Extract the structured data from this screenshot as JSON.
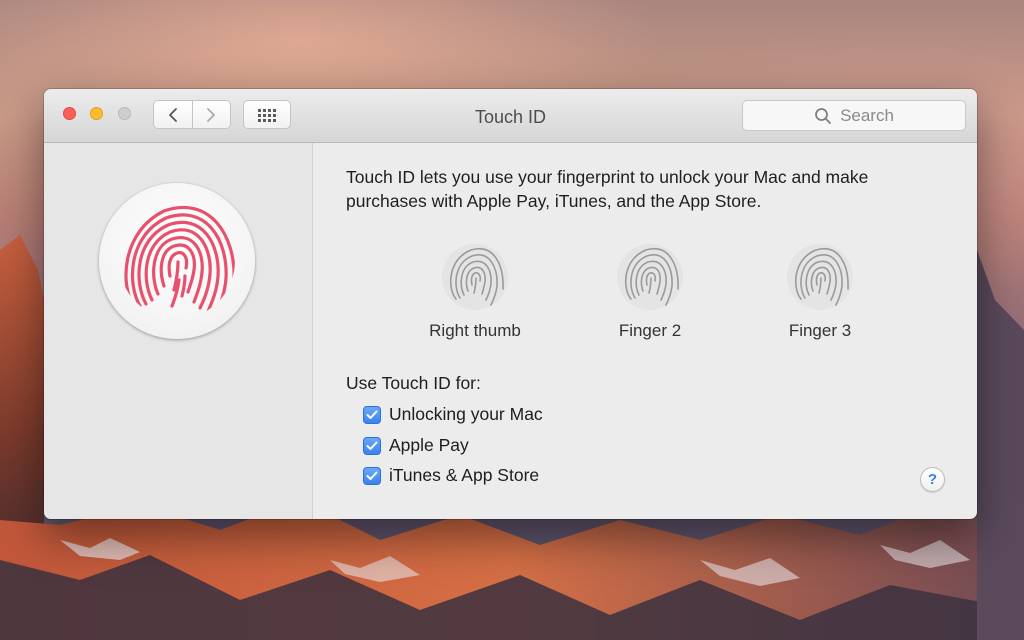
{
  "window": {
    "title": "Touch ID",
    "search": {
      "placeholder": "Search",
      "icon": "search-icon"
    }
  },
  "main": {
    "description": "Touch ID lets you use your fingerprint to unlock your Mac and make purchases with Apple Pay, iTunes, and the App Store.",
    "fingers": [
      {
        "label": "Right thumb"
      },
      {
        "label": "Finger 2"
      },
      {
        "label": "Finger 3"
      }
    ],
    "use_for": {
      "heading": "Use Touch ID for:",
      "options": [
        {
          "label": "Unlocking your Mac",
          "checked": true
        },
        {
          "label": "Apple Pay",
          "checked": true
        },
        {
          "label": "iTunes & App Store",
          "checked": true
        }
      ]
    },
    "help_label": "?"
  },
  "colors": {
    "close": "#fc5f57",
    "minimize": "#fdbc2e",
    "zoom": "#cfcfcf",
    "fingerprint_accent": "#e8506d",
    "checkbox": "#3b82f0"
  }
}
